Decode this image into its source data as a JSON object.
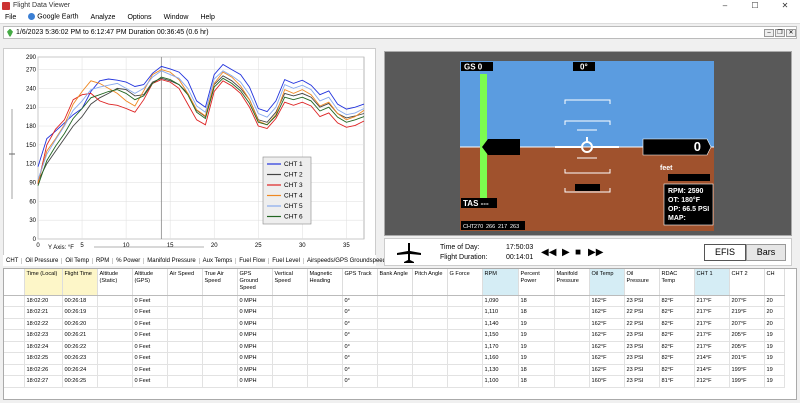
{
  "window": {
    "title": "Flight Data Viewer",
    "min": "–",
    "max": "☐",
    "close": "✕"
  },
  "menu": [
    {
      "label": "File"
    },
    {
      "label": "Google Earth"
    },
    {
      "label": "Analyze"
    },
    {
      "label": "Options"
    },
    {
      "label": "Window"
    },
    {
      "label": "Help"
    }
  ],
  "document": {
    "title": "1/6/2023 5:36:02 PM to 6:12:47 PM   Duration 00:36:45 (0.6 hr)"
  },
  "chart_tabs": [
    "CHT",
    "Oil Pressure",
    "Oil Temp",
    "RPM",
    "% Power",
    "Manifold Pressure",
    "Aux Temps",
    "Fuel Flow",
    "Fuel Level",
    "Airspeeds/GPS Groundspeed",
    "Alti"
  ],
  "chart_data": {
    "type": "line",
    "title": "",
    "xlabel": "",
    "ylabel": "Y Axis: °F",
    "xlim": [
      0,
      37
    ],
    "ylim": [
      0,
      290
    ],
    "x_ticks": [
      0,
      5,
      10,
      15,
      20,
      25,
      30,
      35
    ],
    "y_ticks": [
      0,
      30,
      60,
      90,
      120,
      150,
      180,
      210,
      240,
      270,
      290
    ],
    "cursor_x": 14,
    "legend_position": "bottom-right",
    "x": [
      0,
      1,
      2,
      3,
      4,
      5,
      6,
      7,
      8,
      9,
      10,
      11,
      12,
      13,
      14,
      15,
      16,
      17,
      18,
      19,
      20,
      21,
      22,
      23,
      24,
      25,
      26,
      27,
      28,
      29,
      30,
      31,
      32,
      33,
      34,
      35,
      36,
      37
    ],
    "series": [
      {
        "name": "CHT 1",
        "color": "#2233dd",
        "values": [
          115,
          160,
          172,
          185,
          198,
          208,
          235,
          252,
          255,
          253,
          250,
          243,
          246,
          264,
          275,
          271,
          266,
          252,
          220,
          210,
          262,
          278,
          270,
          262,
          242,
          208,
          203,
          220,
          254,
          248,
          253,
          245,
          230,
          236,
          215,
          207,
          210,
          215
        ]
      },
      {
        "name": "CHT 2",
        "color": "#444444",
        "values": [
          92,
          120,
          140,
          160,
          180,
          195,
          215,
          225,
          232,
          240,
          238,
          228,
          230,
          250,
          256,
          252,
          246,
          232,
          205,
          195,
          246,
          260,
          252,
          240,
          222,
          190,
          186,
          202,
          232,
          228,
          232,
          226,
          210,
          216,
          200,
          193,
          196,
          200
        ]
      },
      {
        "name": "CHT 3",
        "color": "#dd2222",
        "values": [
          88,
          150,
          175,
          190,
          222,
          230,
          232,
          220,
          215,
          213,
          208,
          202,
          222,
          248,
          254,
          250,
          240,
          215,
          190,
          182,
          235,
          252,
          244,
          232,
          210,
          180,
          176,
          192,
          218,
          213,
          218,
          212,
          195,
          201,
          185,
          178,
          181,
          188
        ]
      },
      {
        "name": "CHT 4",
        "color": "#ee8822",
        "values": [
          90,
          140,
          160,
          182,
          215,
          235,
          252,
          248,
          240,
          232,
          220,
          212,
          236,
          262,
          270,
          266,
          254,
          232,
          206,
          196,
          248,
          266,
          258,
          244,
          222,
          188,
          182,
          198,
          238,
          232,
          238,
          230,
          212,
          218,
          200,
          190,
          195,
          205
        ]
      },
      {
        "name": "CHT 5",
        "color": "#88aaee",
        "values": [
          95,
          135,
          158,
          180,
          205,
          220,
          238,
          242,
          245,
          248,
          240,
          232,
          240,
          258,
          268,
          262,
          256,
          240,
          212,
          202,
          255,
          268,
          260,
          250,
          230,
          200,
          194,
          210,
          246,
          240,
          245,
          238,
          220,
          226,
          206,
          198,
          201,
          208
        ]
      },
      {
        "name": "CHT 6",
        "color": "#226622",
        "values": [
          85,
          125,
          148,
          168,
          192,
          208,
          225,
          230,
          235,
          238,
          232,
          222,
          228,
          248,
          258,
          254,
          246,
          230,
          202,
          192,
          242,
          256,
          248,
          236,
          216,
          186,
          182,
          196,
          226,
          222,
          226,
          220,
          204,
          210,
          194,
          186,
          190,
          195
        ]
      }
    ]
  },
  "efis": {
    "gs": "GS 0",
    "heading": "0°",
    "tas": "TAS ---",
    "speed": "0",
    "feet_label": "feet",
    "rpm": "RPM: 2590",
    "ot": "OT: 180°F",
    "op": "OP: 66.5 PSI",
    "map": "MAP:",
    "cht_strip": [
      "CHT",
      "270",
      "266",
      "217",
      "263"
    ],
    "sky_color": "#5b9ce0",
    "ground_color": "#a0522d",
    "bar_color": "#7cfc4f"
  },
  "playback": {
    "tod_label": "Time of Day:",
    "tod_value": "17:50:03",
    "dur_label": "Flight Duration:",
    "dur_value": "00:14:01",
    "controls": [
      "◀◀",
      "▶",
      "■",
      "▶▶"
    ],
    "view_active": "EFIS",
    "view_other": "Bars"
  },
  "table": {
    "columns": [
      {
        "label": "Time (Local)",
        "cls": "time",
        "w": 38
      },
      {
        "label": "Flight Time",
        "cls": "time",
        "w": 35
      },
      {
        "label": "Altitude (Static)",
        "cls": "",
        "w": 35
      },
      {
        "label": "Altitude (GPS)",
        "cls": "",
        "w": 35
      },
      {
        "label": "Air Speed",
        "cls": "",
        "w": 35
      },
      {
        "label": "True Air Speed",
        "cls": "",
        "w": 35
      },
      {
        "label": "GPS Ground Speed",
        "cls": "",
        "w": 35
      },
      {
        "label": "Vertical Speed",
        "cls": "",
        "w": 35
      },
      {
        "label": "Magnetic Heading",
        "cls": "",
        "w": 35
      },
      {
        "label": "GPS Track",
        "cls": "",
        "w": 35
      },
      {
        "label": "Bank Angle",
        "cls": "",
        "w": 35
      },
      {
        "label": "Pitch Angle",
        "cls": "",
        "w": 35
      },
      {
        "label": "G Force",
        "cls": "",
        "w": 35
      },
      {
        "label": "RPM",
        "cls": "eng",
        "w": 36
      },
      {
        "label": "Percent Power",
        "cls": "",
        "w": 36
      },
      {
        "label": "Manifold Pressure",
        "cls": "",
        "w": 35
      },
      {
        "label": "Oil Temp",
        "cls": "eng",
        "w": 35
      },
      {
        "label": "Oil Pressure",
        "cls": "",
        "w": 35
      },
      {
        "label": "RDAC Temp",
        "cls": "",
        "w": 35
      },
      {
        "label": "CHT 1",
        "cls": "eng",
        "w": 35
      },
      {
        "label": "CHT 2",
        "cls": "",
        "w": 35
      },
      {
        "label": "CH",
        "cls": "",
        "w": 20
      }
    ],
    "rows": [
      [
        "18:02:20",
        "00:26:18",
        "",
        "0 Feet",
        "",
        "",
        "0 MPH",
        "",
        "",
        "0°",
        "",
        "",
        "",
        "1,090",
        "18",
        "",
        "162°F",
        "23 PSI",
        "82°F",
        "217°F",
        "207°F",
        "20"
      ],
      [
        "18:02:21",
        "00:26:19",
        "",
        "0 Feet",
        "",
        "",
        "0 MPH",
        "",
        "",
        "0°",
        "",
        "",
        "",
        "1,110",
        "18",
        "",
        "162°F",
        "22 PSI",
        "82°F",
        "217°F",
        "219°F",
        "20"
      ],
      [
        "18:02:22",
        "00:26:20",
        "",
        "0 Feet",
        "",
        "",
        "0 MPH",
        "",
        "",
        "0°",
        "",
        "",
        "",
        "1,140",
        "19",
        "",
        "162°F",
        "22 PSI",
        "82°F",
        "217°F",
        "207°F",
        "20"
      ],
      [
        "18:02:23",
        "00:26:21",
        "",
        "0 Feet",
        "",
        "",
        "0 MPH",
        "",
        "",
        "0°",
        "",
        "",
        "",
        "1,150",
        "19",
        "",
        "162°F",
        "23 PSI",
        "82°F",
        "217°F",
        "205°F",
        "19"
      ],
      [
        "18:02:24",
        "00:26:22",
        "",
        "0 Feet",
        "",
        "",
        "0 MPH",
        "",
        "",
        "0°",
        "",
        "",
        "",
        "1,170",
        "19",
        "",
        "162°F",
        "23 PSI",
        "82°F",
        "217°F",
        "205°F",
        "19"
      ],
      [
        "18:02:25",
        "00:26:23",
        "",
        "0 Feet",
        "",
        "",
        "0 MPH",
        "",
        "",
        "0°",
        "",
        "",
        "",
        "1,160",
        "19",
        "",
        "162°F",
        "23 PSI",
        "82°F",
        "214°F",
        "201°F",
        "19"
      ],
      [
        "18:02:26",
        "00:26:24",
        "",
        "0 Feet",
        "",
        "",
        "0 MPH",
        "",
        "",
        "0°",
        "",
        "",
        "",
        "1,130",
        "18",
        "",
        "162°F",
        "23 PSI",
        "82°F",
        "214°F",
        "199°F",
        "19"
      ],
      [
        "18:02:27",
        "00:26:25",
        "",
        "0 Feet",
        "",
        "",
        "0 MPH",
        "",
        "",
        "0°",
        "",
        "",
        "",
        "1,100",
        "18",
        "",
        "160°F",
        "23 PSI",
        "81°F",
        "212°F",
        "199°F",
        "19"
      ]
    ]
  }
}
